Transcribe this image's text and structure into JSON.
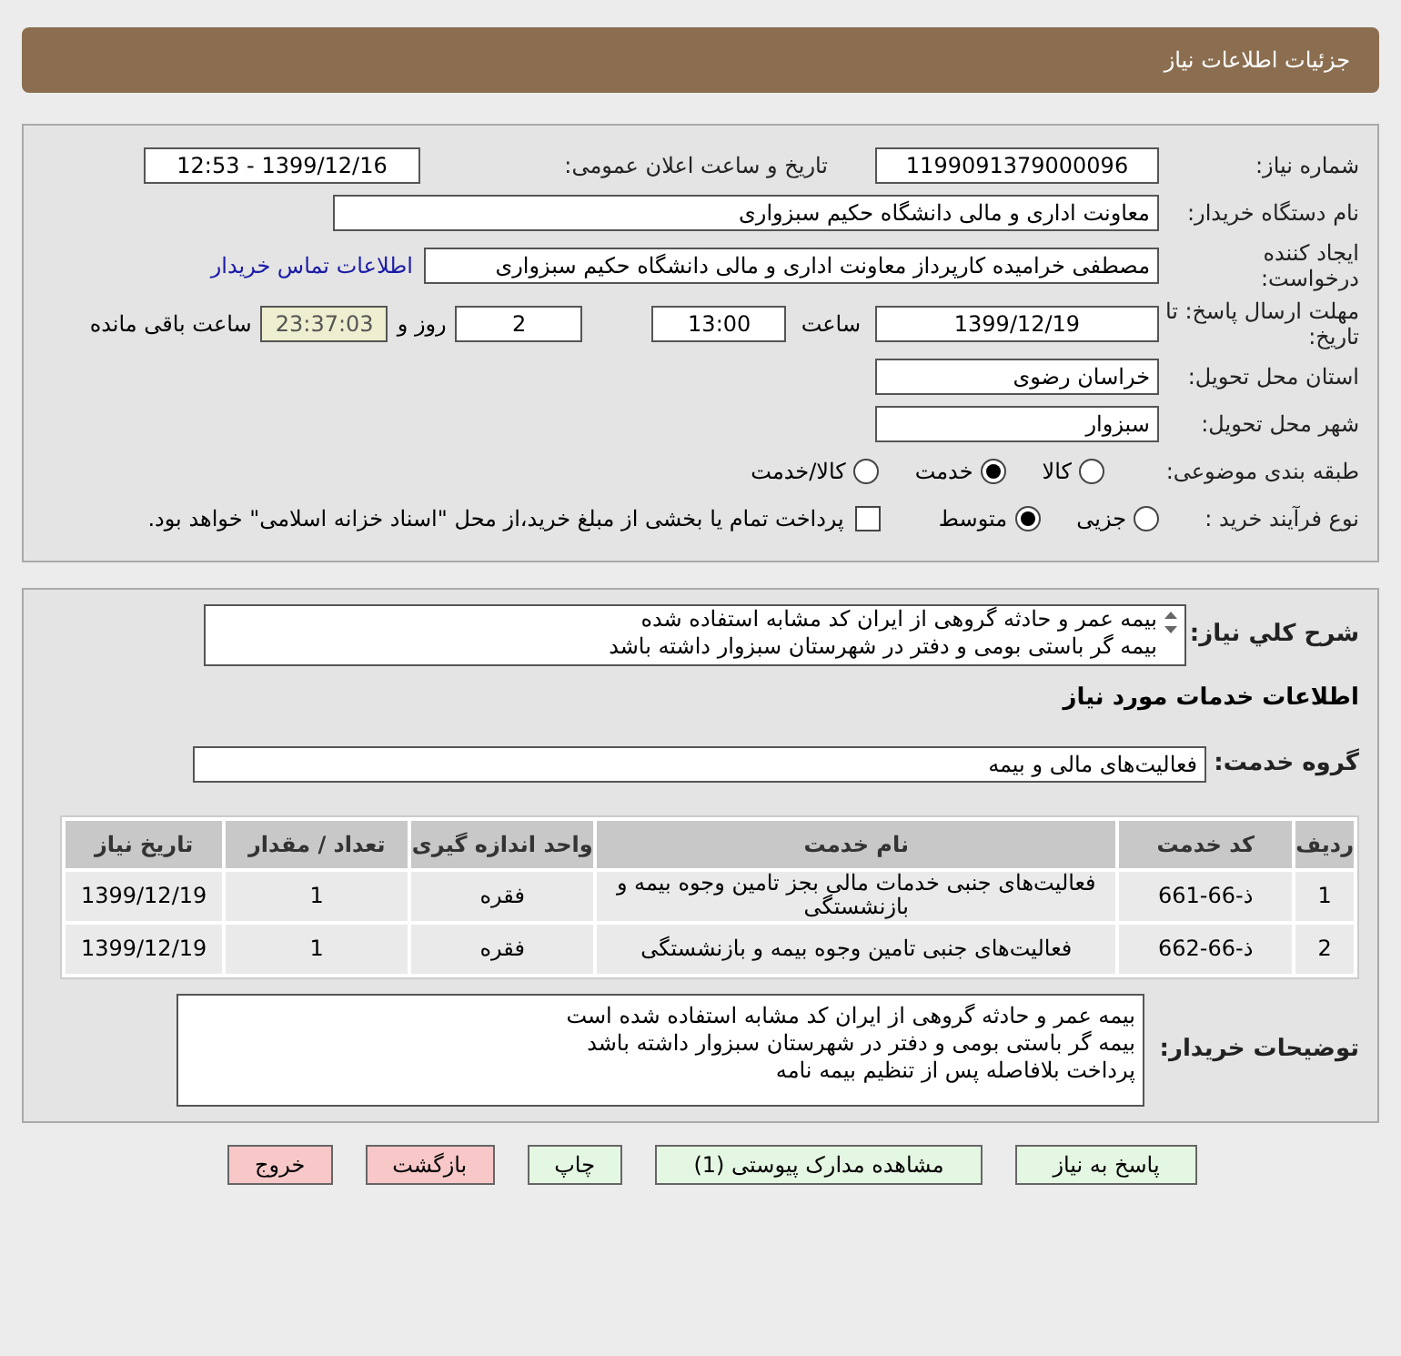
{
  "header": {
    "title": "جزئیات اطلاعات نیاز"
  },
  "need_number": {
    "label": "شماره نیاز:",
    "value": "1199091379000096"
  },
  "announce": {
    "label": "تاریخ و ساعت اعلان عمومی:",
    "value": "1399/12/16 - 12:53"
  },
  "buyer_org": {
    "label": "نام دستگاه خریدار:",
    "value": "معاونت اداری و مالی دانشگاه حکیم سبزواری"
  },
  "creator": {
    "label": "ایجاد کننده درخواست:",
    "value": "مصطفی خرامیده کارپرداز معاونت اداری و مالی دانشگاه حکیم سبزواری",
    "link": "اطلاعات تماس خریدار"
  },
  "deadline": {
    "label": "مهلت ارسال پاسخ: تا تاریخ:",
    "date": "1399/12/19",
    "time_label": "ساعت",
    "time": "13:00",
    "days": "2",
    "days_label": "روز و",
    "remaining": "23:37:03",
    "remaining_label": "ساعت باقی مانده"
  },
  "province": {
    "label": "استان محل تحویل:",
    "value": "خراسان رضوی"
  },
  "city": {
    "label": "شهر محل تحویل:",
    "value": "سبزوار"
  },
  "category": {
    "label": "طبقه بندی موضوعی:",
    "options": [
      {
        "label": "کالا",
        "selected": false
      },
      {
        "label": "خدمت",
        "selected": true
      },
      {
        "label": "کالا/خدمت",
        "selected": false
      }
    ]
  },
  "purchase_type": {
    "label": "نوع فرآیند خرید :",
    "options": [
      {
        "label": "جزیی",
        "selected": false
      },
      {
        "label": "متوسط",
        "selected": true
      }
    ],
    "payment_checkbox": {
      "label": "پرداخت تمام یا بخشی از مبلغ خرید،از محل \"اسناد خزانه اسلامی\" خواهد بود.",
      "checked": false
    }
  },
  "description": {
    "label": "شرح كلي نياز:",
    "lines": [
      "بیمه عمر و حادثه گروهی از ایران کد مشابه استفاده شده",
      "بیمه گر باستی بومی و دفتر در شهرستان سبزوار داشته باشد"
    ]
  },
  "services_title": "اطلاعات خدمات مورد نیاز",
  "service_group": {
    "label": "گروه خدمت:",
    "value": "فعالیت‌های مالی و بیمه"
  },
  "table": {
    "columns": [
      "ردیف",
      "کد خدمت",
      "نام خدمت",
      "واحد اندازه گیری",
      "تعداد / مقدار",
      "تاریخ نیاز"
    ],
    "rows": [
      [
        "1",
        "ذ-66-661",
        "فعالیت‌های جنبی خدمات مالی بجز تامین وجوه بیمه و بازنشستگی",
        "فقره",
        "1",
        "1399/12/19"
      ],
      [
        "2",
        "ذ-66-662",
        "فعالیت‌های جنبی تامین وجوه بیمه و بازنشستگی",
        "فقره",
        "1",
        "1399/12/19"
      ]
    ]
  },
  "buyer_notes": {
    "label": "توضیحات خریدار:",
    "lines": [
      "بیمه عمر و حادثه گروهی از ایران کد مشابه استفاده شده است",
      "بیمه گر باستی بومی و دفتر در شهرستان سبزوار داشته باشد",
      "پرداخت بلافاصله پس از تنظیم بیمه نامه"
    ]
  },
  "buttons": [
    {
      "label": "پاسخ به نیاز",
      "kind": "primary"
    },
    {
      "label": "مشاهده مدارک پیوستی (1)",
      "kind": "primary"
    },
    {
      "label": "چاپ",
      "kind": "primary"
    },
    {
      "label": "بازگشت",
      "kind": "danger"
    },
    {
      "label": "خروج",
      "kind": "danger"
    }
  ]
}
